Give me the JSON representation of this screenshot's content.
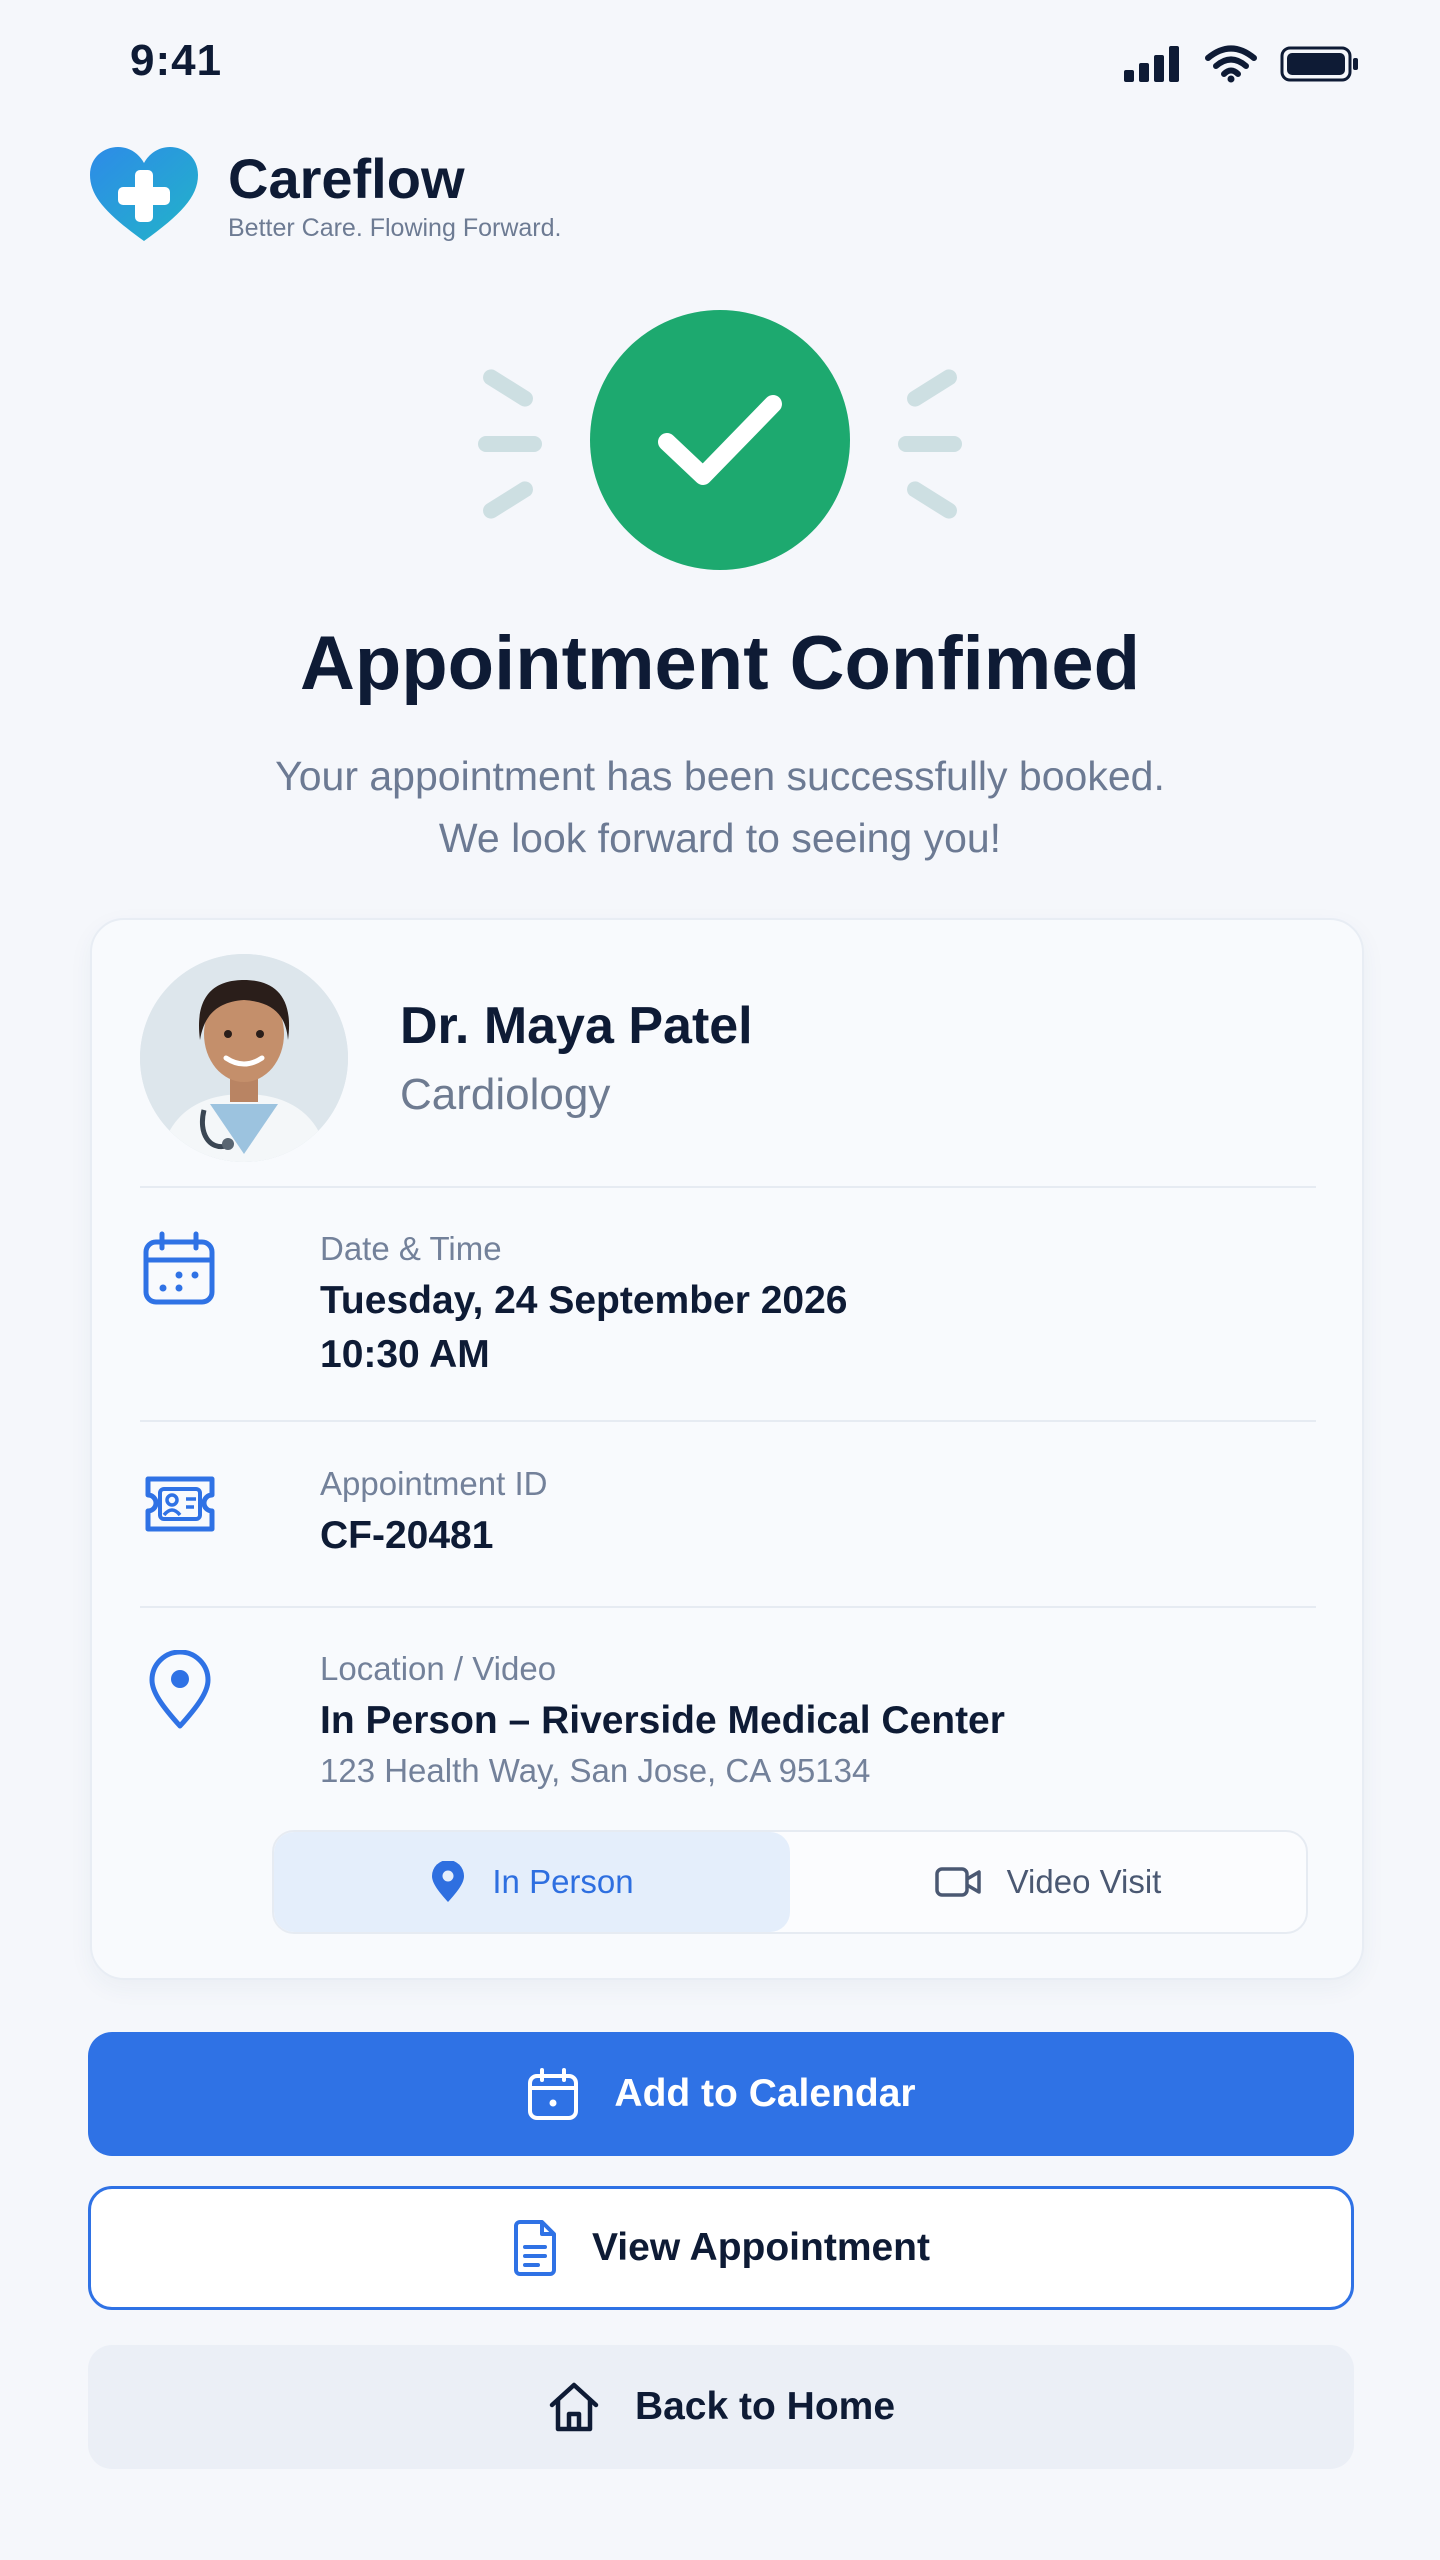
{
  "status_bar": {
    "time": "9:41"
  },
  "brand": {
    "name": "Careflow",
    "tagline": "Better Care. Flowing Forward."
  },
  "confirmation": {
    "title": "Appointment Confimed",
    "subtitle": "Your appointment has been successfully booked. We look forward to seeing you!"
  },
  "doctor": {
    "name": "Dr. Maya Patel",
    "specialty": "Cardiology"
  },
  "details": {
    "date_time": {
      "label": "Date & Time",
      "date": "Tuesday, 24 September 2026",
      "time": "10:30 AM"
    },
    "appointment_id": {
      "label": "Appointment ID",
      "value": "CF-20481"
    },
    "location": {
      "label": "Location / Video",
      "value": "In Person – Riverside Medical Center",
      "address": "123 Health Way, San Jose, CA 95134"
    }
  },
  "visit_type": {
    "options": [
      {
        "label": "In Person",
        "icon": "map-pin-icon",
        "selected": true
      },
      {
        "label": "Video Visit",
        "icon": "video-camera-icon",
        "selected": false
      }
    ]
  },
  "actions": {
    "add_to_calendar": "Add to Calendar",
    "view_appointment": "View Appointment",
    "back_to_home": "Back to Home"
  },
  "colors": {
    "accent": "#2f72e5",
    "success": "#1da96f",
    "text": "#0e1b35",
    "muted": "#6c7a93"
  }
}
